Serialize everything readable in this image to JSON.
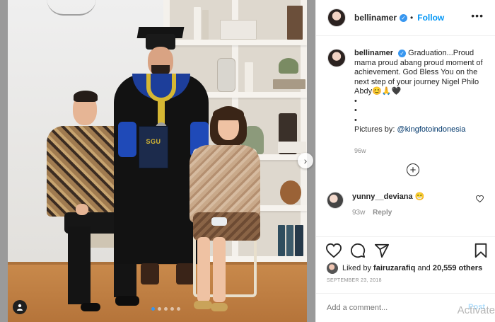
{
  "post": {
    "username": "bellinamer",
    "follow_label": "Follow",
    "more_label": "•••",
    "caption": {
      "username": "bellinamer",
      "text": "Graduation...Proud mama proud abang proud moment of achievement. God Bless You on the next step of your journey Nigel Philo Abdy",
      "emojis": "😊🙏🖤",
      "bullets": [
        "•",
        "•",
        "•"
      ],
      "pictures_prefix": "Pictures by: ",
      "pictures_mention": "@kingfotoindonesia",
      "time": "96w"
    },
    "load_more_label": "+",
    "comment": {
      "username": "yunny__deviana",
      "text": "😁",
      "time": "93w",
      "reply_label": "Reply"
    },
    "likes": {
      "prefix": "Liked by ",
      "user": "fairuzarafiq",
      "middle": " and ",
      "count": "20,559 others"
    },
    "date": "SEPTEMBER 23, 2018",
    "add_comment_placeholder": "Add a comment...",
    "post_label": "Post",
    "carousel": {
      "count": 5,
      "active": 0
    }
  },
  "photo": {
    "diploma_label": "SGU"
  },
  "overlay": {
    "watermark": "Activate"
  },
  "icons": {
    "verified": "verified-badge-icon",
    "heart": "heart-icon",
    "comment": "comment-icon",
    "share": "share-icon",
    "save": "bookmark-icon",
    "tag": "user-tag-icon",
    "next": "chevron-right-icon"
  },
  "colors": {
    "accent": "#0095f6",
    "text": "#262626",
    "muted": "#8e8e8e",
    "mention": "#00376b"
  }
}
